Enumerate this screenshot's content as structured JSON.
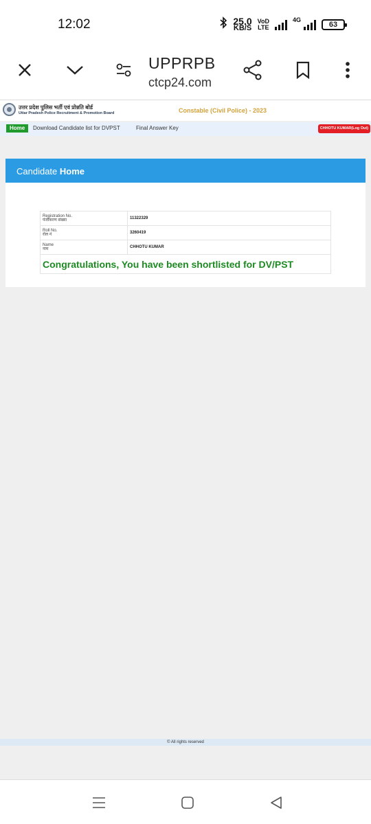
{
  "status_bar": {
    "time": "12:02",
    "net_speed_value": "25.0",
    "net_speed_unit": "KB/S",
    "volte_top": "VoD",
    "volte_bottom": "LTE",
    "net_type": "4G",
    "battery": "63"
  },
  "browser": {
    "title": "UPPRPB",
    "url": "ctcp24.com",
    "icons": [
      "close-icon",
      "chevron-down-icon",
      "tune-icon",
      "share-icon",
      "bookmark-icon",
      "more-vert-icon"
    ]
  },
  "site": {
    "board_name_hi": "उत्तर प्रदेश पुलिस भर्ती एवं प्रोन्नति बोर्ड",
    "board_name_en": "Uttar Pradesh Police Recruitment & Promotion Board",
    "exam_title": "Constable (Civil Police) - 2023",
    "nav": {
      "home": "Home",
      "download_link": "Download Candidate list for DVPST",
      "answer_key_link": "Final Answer Key",
      "logout": "CHHOTU KUMAR(Log Out)"
    },
    "card": {
      "title_prefix": "Candidate",
      "title_bold": "Home",
      "rows": [
        {
          "label_en": "Registration No.",
          "label_hi": "पंजीकरण संख्या",
          "value": "11322329"
        },
        {
          "label_en": "Roll No.",
          "label_hi": "रोल नं",
          "value": "3260419"
        },
        {
          "label_en": "Name",
          "label_hi": "नाम",
          "value": "CHHOTU KUMAR"
        }
      ],
      "message": "Congratulations, You have been shortlisted for DV/PST"
    },
    "footer": "© All rights reserved"
  },
  "colors": {
    "header_blue": "#2b9be3",
    "success_green": "#1d8a22",
    "home_green": "#1f9a2c",
    "logout_red": "#e31e24",
    "exam_gold": "#d4a23a"
  },
  "system_nav": [
    "recent-apps-icon",
    "home-icon",
    "back-icon"
  ]
}
